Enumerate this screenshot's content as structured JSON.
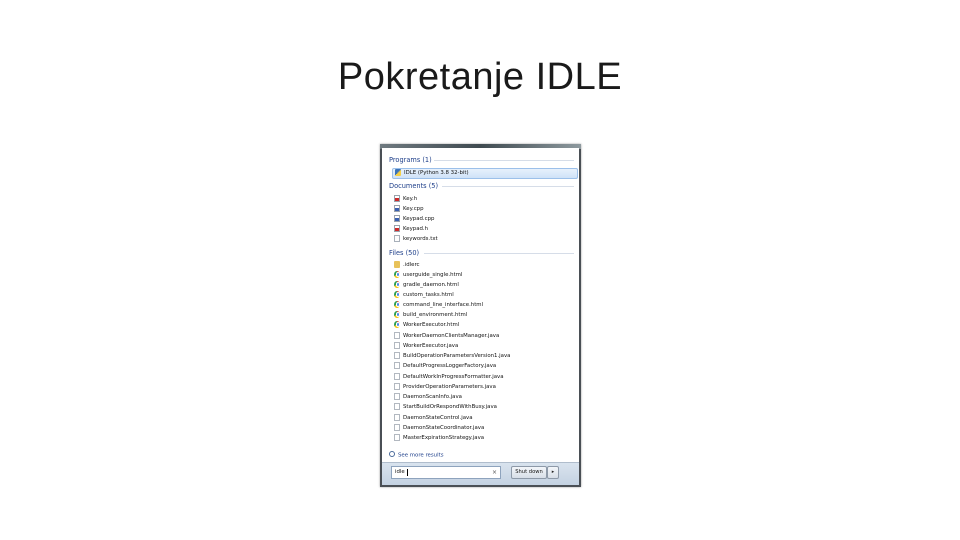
{
  "slide": {
    "title": "Pokretanje IDLE"
  },
  "programs": {
    "header": "Programs (1)",
    "items": [
      {
        "label": "IDLE (Python 3.8 32-bit)",
        "icon": "python-icon"
      }
    ]
  },
  "documents": {
    "header": "Documents (5)",
    "items": [
      {
        "label": "Key.h",
        "icon": "h-file-icon"
      },
      {
        "label": "Key.cpp",
        "icon": "cpp-file-icon"
      },
      {
        "label": "Keypad.cpp",
        "icon": "cpp-file-icon"
      },
      {
        "label": "Keypad.h",
        "icon": "h-file-icon"
      },
      {
        "label": "keywords.txt",
        "icon": "text-file-icon"
      }
    ]
  },
  "files": {
    "header": "Files (50)",
    "items": [
      {
        "label": ".idlerc",
        "icon": "folder-icon"
      },
      {
        "label": "userguide_single.html",
        "icon": "chrome-icon"
      },
      {
        "label": "gradle_daemon.html",
        "icon": "chrome-icon"
      },
      {
        "label": "custom_tasks.html",
        "icon": "chrome-icon"
      },
      {
        "label": "command_line_interface.html",
        "icon": "chrome-icon"
      },
      {
        "label": "build_environment.html",
        "icon": "chrome-icon"
      },
      {
        "label": "WorkerExecutor.html",
        "icon": "chrome-icon"
      },
      {
        "label": "WorkerDaemonClientsManager.java",
        "icon": "file-icon"
      },
      {
        "label": "WorkerExecutor.java",
        "icon": "file-icon"
      },
      {
        "label": "BuildOperationParametersVersion1.java",
        "icon": "file-icon"
      },
      {
        "label": "DefaultProgressLoggerFactory.java",
        "icon": "file-icon"
      },
      {
        "label": "DefaultWorkInProgressFormatter.java",
        "icon": "file-icon"
      },
      {
        "label": "ProviderOperationParameters.java",
        "icon": "file-icon"
      },
      {
        "label": "DaemonScanInfo.java",
        "icon": "file-icon"
      },
      {
        "label": "StartBuildOrRespondWithBusy.java",
        "icon": "file-icon"
      },
      {
        "label": "DaemonStateControl.java",
        "icon": "file-icon"
      },
      {
        "label": "DaemonStateCoordinator.java",
        "icon": "file-icon"
      },
      {
        "label": "MasterExpirationStrategy.java",
        "icon": "file-icon"
      }
    ]
  },
  "see_more": "See more results",
  "search": {
    "value": "idle",
    "clear_glyph": "×"
  },
  "shutdown": {
    "label": "Shut down",
    "arrow_glyph": "▸"
  }
}
